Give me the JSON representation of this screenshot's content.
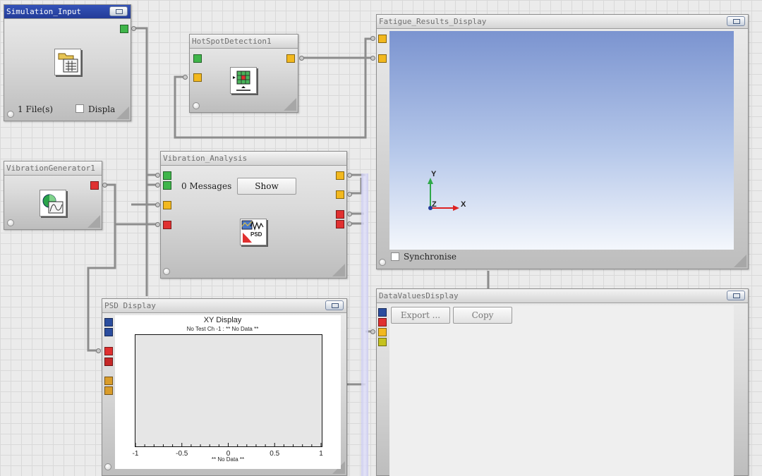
{
  "nodes": {
    "simulation_input": {
      "title": "Simulation_Input",
      "files_label": "1 File(s)",
      "display_checkbox_label": "Displa"
    },
    "hotspot_detection": {
      "title": "HotSpotDetection1"
    },
    "fatigue_results": {
      "title": "Fatigue_Results_Display",
      "synchronise_label": "Synchronise",
      "triad": {
        "y_label": "Y",
        "x_label": "X",
        "z_label": "Z"
      }
    },
    "vibration_generator": {
      "title": "VibrationGenerator1"
    },
    "vibration_analysis": {
      "title": "Vibration_Analysis",
      "messages_label": "0 Messages",
      "show_button": "Show",
      "icon_text": "PSD"
    },
    "psd_display": {
      "title": "PSD Display"
    },
    "data_values": {
      "title": "DataValuesDisplay",
      "export_button": "Export ...",
      "copy_button": "Copy"
    }
  },
  "chart_data": {
    "type": "line",
    "title": "XY Display",
    "subtitle": "No Test Ch -1 : ** No Data **",
    "xlabel": "** No Data **",
    "x_ticks": [
      "-1",
      "-0.5",
      "0",
      "0.5",
      "1"
    ],
    "xlim": [
      -1,
      1
    ],
    "series": [],
    "grid": false
  },
  "colors": {
    "active_title": "#233c98",
    "port_green": "#3fb54a",
    "port_yellow": "#f2b81e",
    "port_red": "#e03030",
    "port_blue": "#2b4d9e",
    "wire": "#8a8a8a"
  }
}
